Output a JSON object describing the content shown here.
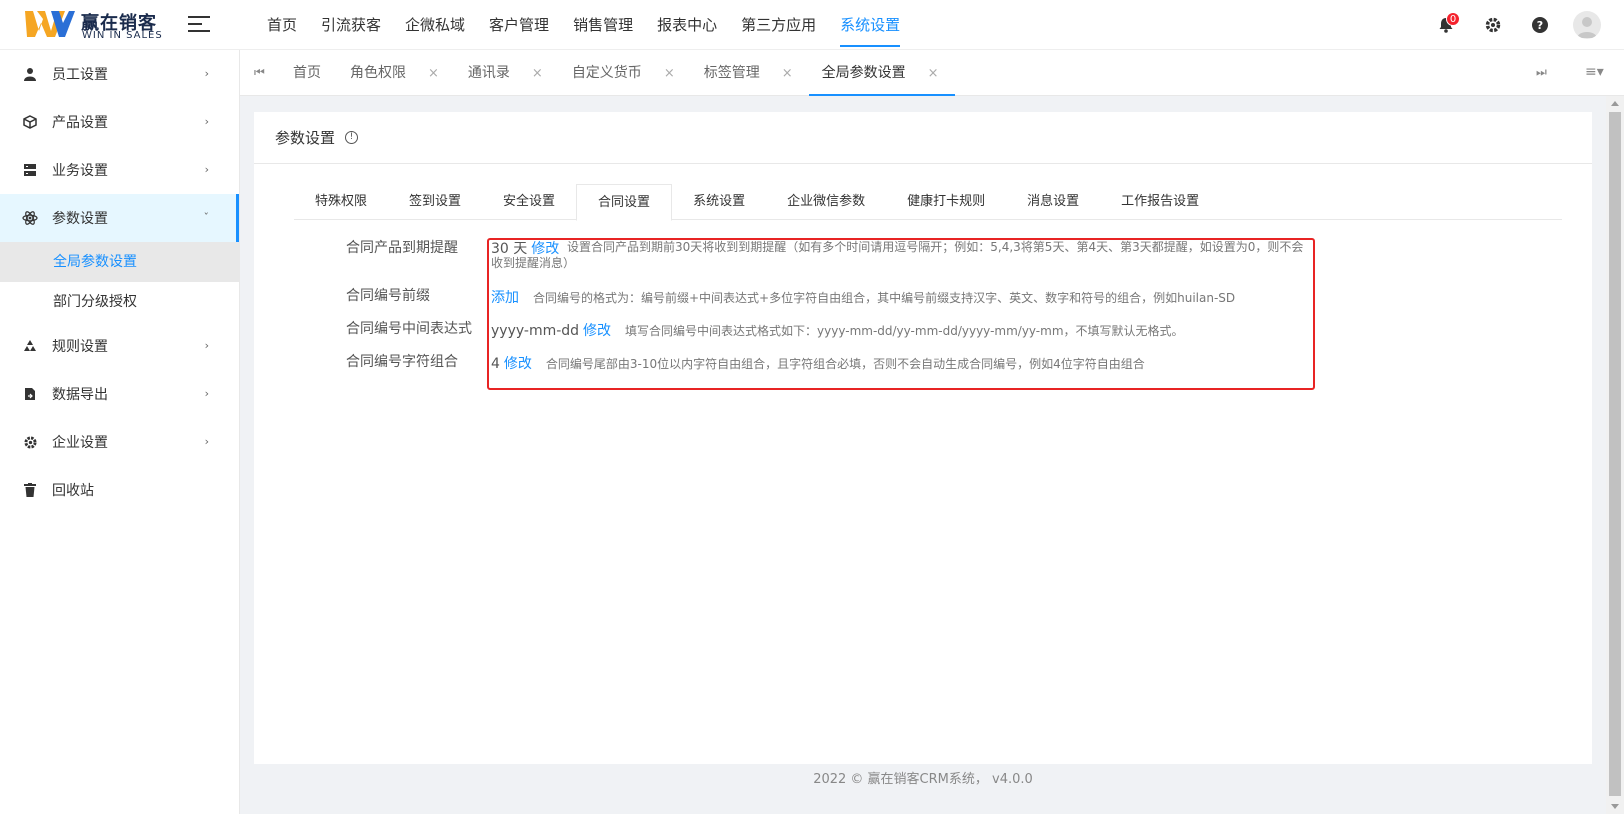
{
  "app": {
    "logo_cn": "赢在销客",
    "logo_en": "WIN IN SALES"
  },
  "topnav": {
    "items": [
      "首页",
      "引流获客",
      "企微私域",
      "客户管理",
      "销售管理",
      "报表中心",
      "第三方应用",
      "系统设置"
    ],
    "active": "系统设置"
  },
  "toolbar": {
    "icons": [
      "theme-moon-icon",
      "bell-icon",
      "gear-icon",
      "help-icon",
      "user-avatar-icon"
    ],
    "notification_count": "0"
  },
  "sidebar": {
    "items": [
      {
        "label": "员工设置",
        "icon": "user-icon"
      },
      {
        "label": "产品设置",
        "icon": "box-icon"
      },
      {
        "label": "业务设置",
        "icon": "server-icon"
      },
      {
        "label": "参数设置",
        "icon": "atom-icon"
      },
      {
        "label": "规则设置",
        "icon": "recycle-icon"
      },
      {
        "label": "数据导出",
        "icon": "file-export-icon"
      },
      {
        "label": "企业设置",
        "icon": "gear-icon"
      },
      {
        "label": "回收站",
        "icon": "trash-icon"
      }
    ],
    "submenu": [
      "全局参数设置",
      "部门分级授权"
    ],
    "active_sub": "全局参数设置"
  },
  "tabs": {
    "items": [
      "首页",
      "角色权限",
      "通讯录",
      "自定义货币",
      "标签管理",
      "全局参数设置"
    ],
    "close_glyph": "×",
    "active": "全局参数设置"
  },
  "card": {
    "title": "参数设置",
    "info_glyph": "!"
  },
  "subtabs": {
    "items": [
      "特殊权限",
      "签到设置",
      "安全设置",
      "合同设置",
      "系统设置",
      "企业微信参数",
      "健康打卡规则",
      "消息设置",
      "工作报告设置"
    ],
    "active": "合同设置"
  },
  "params": [
    {
      "label": "合同产品到期提醒",
      "value": "30 天",
      "action": "修改",
      "desc_line1": "设置合同产品到期前30天将收到到期提醒（如有多个时间请用逗号隔开；例如：5,4,3将第5天、第4天、第3天都提醒，如设置为0，则不会",
      "desc_line2": "收到提醒消息）"
    },
    {
      "label": "合同编号前缀",
      "value": "",
      "action": "添加",
      "desc": "合同编号的格式为：编号前缀+中间表达式+多位字符自由组合，其中编号前缀支持汉字、英文、数字和符号的组合，例如huilan-SD"
    },
    {
      "label": "合同编号中间表达式",
      "value": "yyyy-mm-dd",
      "action": "修改",
      "desc": "填写合同编号中间表达式格式如下：yyyy-mm-dd/yy-mm-dd/yyyy-mm/yy-mm，不填写默认无格式。"
    },
    {
      "label": "合同编号字符组合",
      "value": "4",
      "action": "修改",
      "desc": "合同编号尾部由3-10位以内字符自由组合，且字符组合必填，否则不会自动生成合同编号，例如4位字符自由组合"
    }
  ],
  "footer": {
    "text": "2022 © 赢在销客CRM系统， v4.0.0"
  },
  "colors": {
    "accent": "#1890ff",
    "highlight_border": "#e82424",
    "badge": "#f5222d"
  }
}
